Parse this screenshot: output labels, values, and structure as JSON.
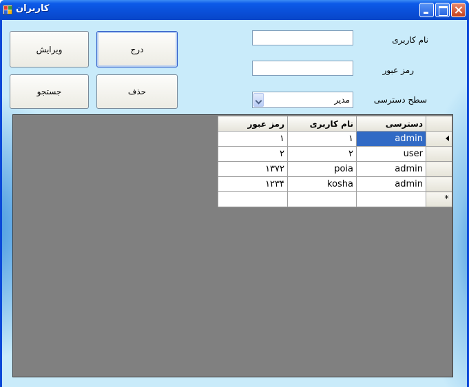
{
  "window": {
    "title": "کاربران",
    "controls": {
      "minimize": "minimize-icon",
      "maximize": "maximize-icon",
      "close": "close-icon"
    }
  },
  "buttons": {
    "insert": "درج",
    "edit": "ویرایش",
    "delete": "حذف",
    "search": "جستجو"
  },
  "form": {
    "username_label": "نام کاربری",
    "password_label": "رمز عبور",
    "access_level_label": "سطح دسترسی",
    "username_value": "",
    "password_value": "",
    "access_level_value": "مدیر"
  },
  "grid": {
    "columns": [
      "دسترسی",
      "نام کاربری",
      "رمز عبور"
    ],
    "rows": [
      {
        "access": "admin",
        "username": "۱",
        "password": "۱"
      },
      {
        "access": "user",
        "username": "۲",
        "password": "۲"
      },
      {
        "access": "admin",
        "username": "poia",
        "password": "۱۳۷۲"
      },
      {
        "access": "admin",
        "username": "kosha",
        "password": "۱۲۳۴"
      }
    ],
    "new_row_marker": "*",
    "selected_row": 0
  }
}
